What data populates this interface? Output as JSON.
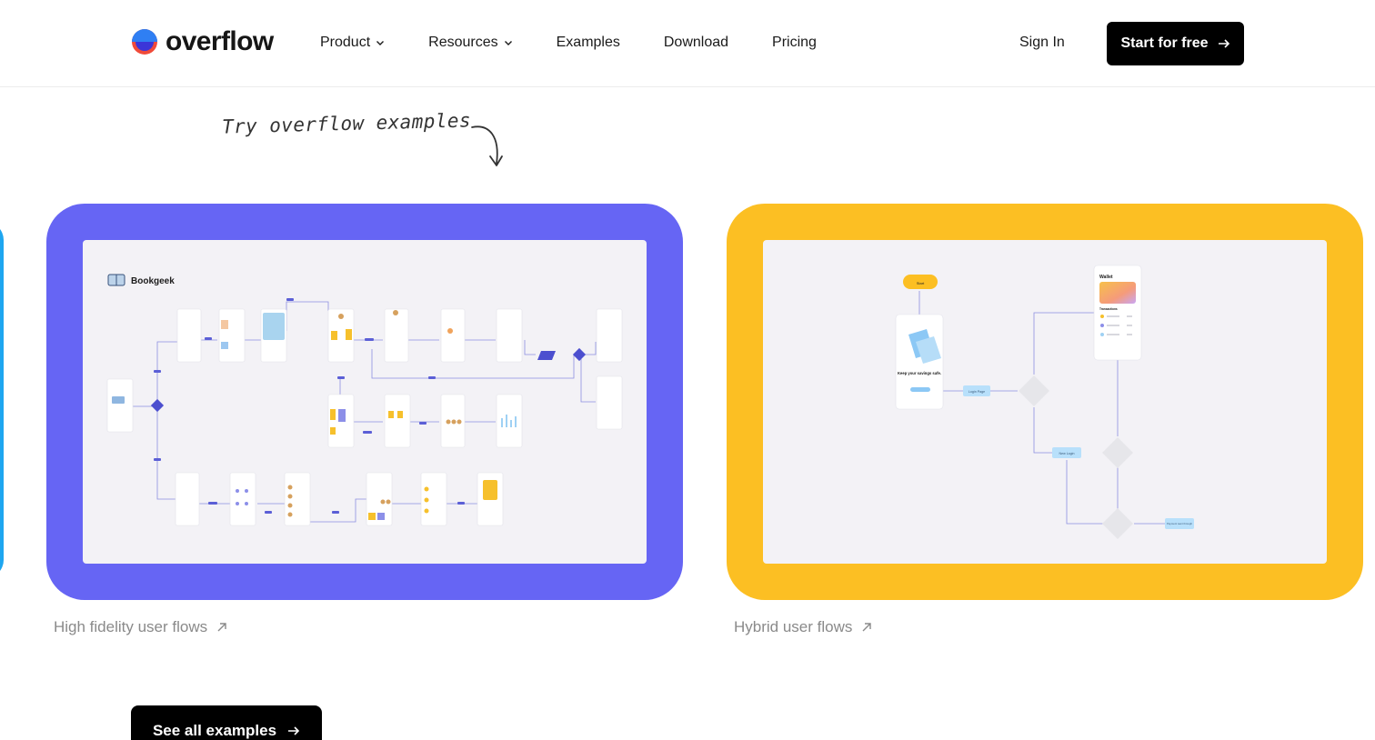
{
  "header": {
    "logo_text": "overflow",
    "nav": [
      {
        "label": "Product",
        "has_dropdown": true
      },
      {
        "label": "Resources",
        "has_dropdown": true
      },
      {
        "label": "Examples",
        "has_dropdown": false
      },
      {
        "label": "Download",
        "has_dropdown": false
      },
      {
        "label": "Pricing",
        "has_dropdown": false
      }
    ],
    "sign_in": "Sign In",
    "cta": "Start for free"
  },
  "callout": "Try overflow examples",
  "examples": [
    {
      "caption": "High fidelity user flows",
      "accent": "#6665f4",
      "board_title": "Bookgeek"
    },
    {
      "caption": "Hybrid user flows",
      "accent": "#fcbf23",
      "mini": {
        "start": "Start",
        "headline": "Keep your savings safe.",
        "login_page": "Login Page",
        "new_login": "New Login",
        "wallet": "Wallet",
        "transactions": "Transactions",
        "payment_detail": "Payment went through"
      }
    }
  ],
  "see_all": "See all examples",
  "colors": {
    "edge_card": "#1ea6f0",
    "card_inner": "#f3f2f6"
  }
}
